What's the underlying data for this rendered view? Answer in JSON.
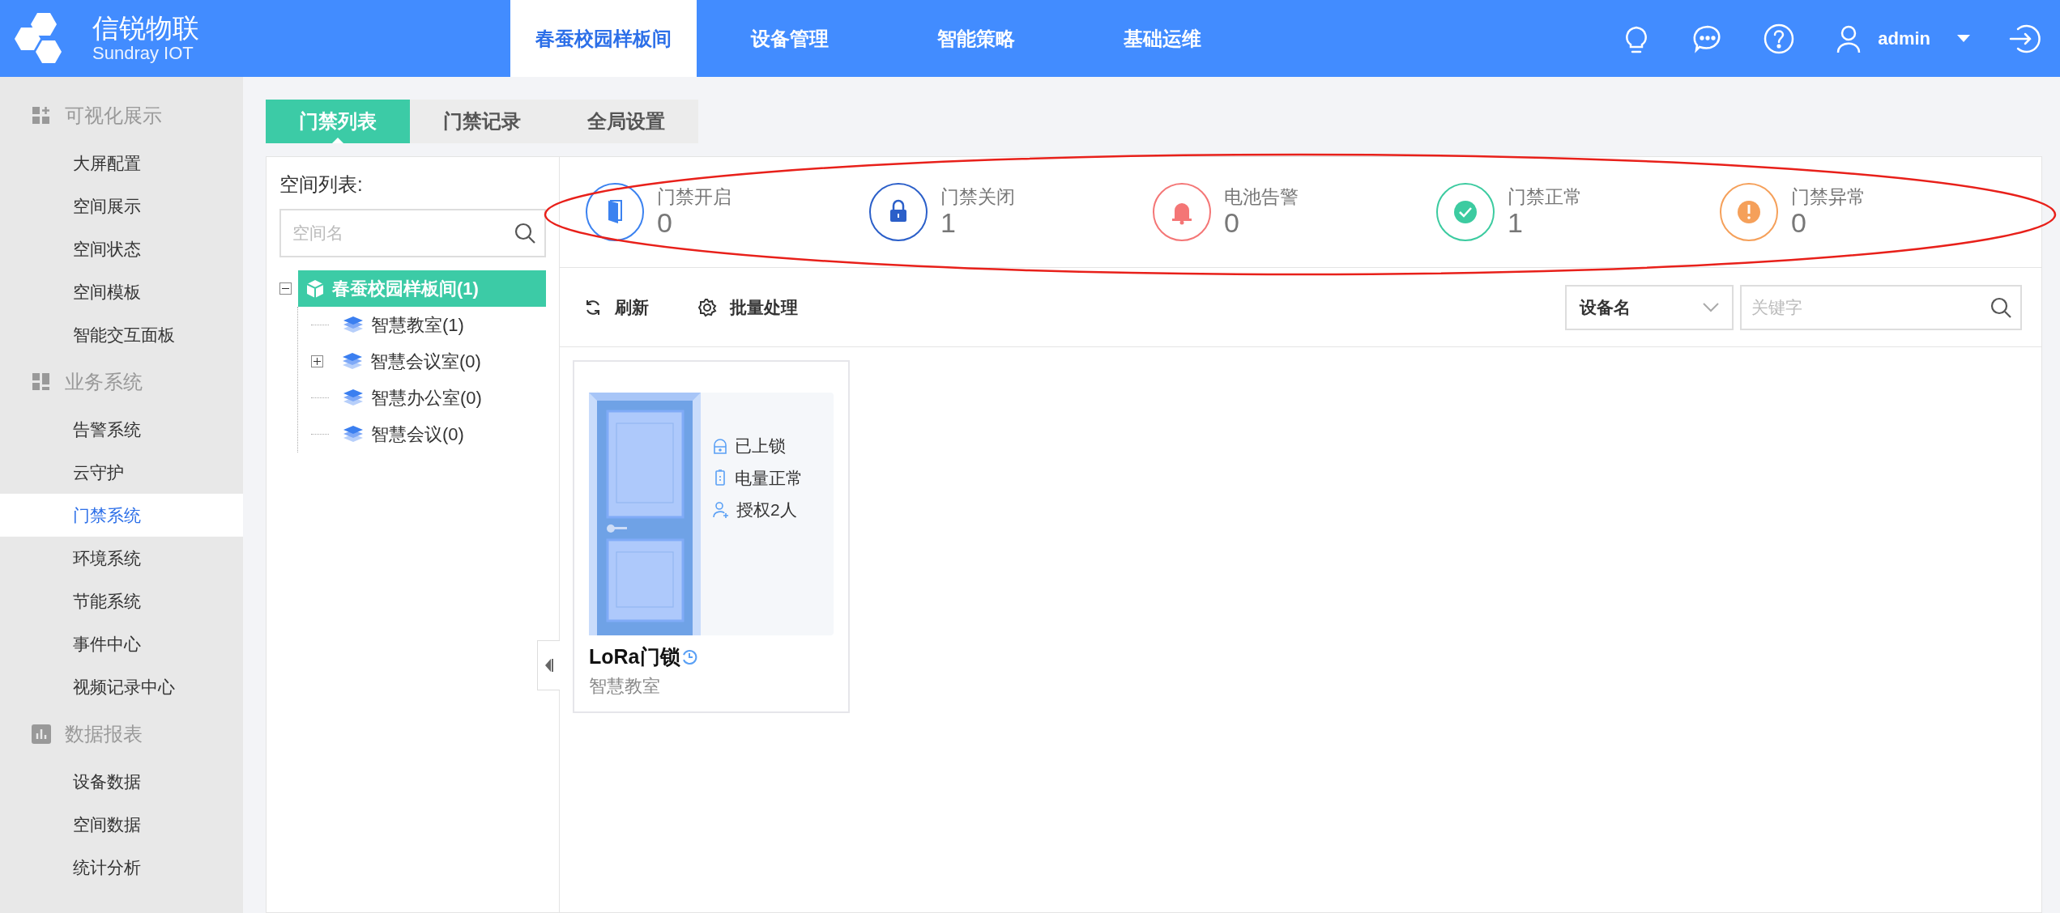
{
  "header": {
    "logo_title": "信锐物联",
    "logo_subtitle": "Sundray IOT",
    "user": "admin",
    "nav": [
      {
        "label": "春蚕校园样板间",
        "selected": true
      },
      {
        "label": "设备管理",
        "selected": false
      },
      {
        "label": "智能策略",
        "selected": false
      },
      {
        "label": "基础运维",
        "selected": false
      }
    ]
  },
  "sidebar": {
    "groups": [
      {
        "title": "可视化展示",
        "kind": "grid",
        "items": [
          {
            "label": "大屏配置",
            "selected": false
          },
          {
            "label": "空间展示",
            "selected": false
          },
          {
            "label": "空间状态",
            "selected": false
          },
          {
            "label": "空间模板",
            "selected": false
          },
          {
            "label": "智能交互面板",
            "selected": false
          }
        ]
      },
      {
        "title": "业务系统",
        "kind": "layout",
        "items": [
          {
            "label": "告警系统",
            "selected": false
          },
          {
            "label": "云守护",
            "selected": false
          },
          {
            "label": "门禁系统",
            "selected": true
          },
          {
            "label": "环境系统",
            "selected": false
          },
          {
            "label": "节能系统",
            "selected": false
          },
          {
            "label": "事件中心",
            "selected": false
          },
          {
            "label": "视频记录中心",
            "selected": false
          }
        ]
      },
      {
        "title": "数据报表",
        "kind": "chart",
        "items": [
          {
            "label": "设备数据",
            "selected": false
          },
          {
            "label": "空间数据",
            "selected": false
          },
          {
            "label": "统计分析",
            "selected": false
          }
        ]
      }
    ]
  },
  "tabs": [
    {
      "label": "门禁列表",
      "selected": true
    },
    {
      "label": "门禁记录",
      "selected": false
    },
    {
      "label": "全局设置",
      "selected": false
    }
  ],
  "space_panel": {
    "title": "空间列表:",
    "search": {
      "placeholder": "空间名"
    },
    "tree": [
      {
        "label": "春蚕校园样板间(1)",
        "selected": true,
        "expanded": true,
        "children": [
          {
            "label": "智慧教室(1)",
            "selected": false
          },
          {
            "label": "智慧会议室(0)",
            "selected": false,
            "expanded": false
          },
          {
            "label": "智慧办公室(0)",
            "selected": false
          },
          {
            "label": "智慧会议(0)",
            "selected": false
          }
        ]
      }
    ]
  },
  "stats": [
    {
      "kind": "open",
      "label": "门禁开启",
      "value": "0",
      "color": "#3b82f0"
    },
    {
      "kind": "closed",
      "label": "门禁关闭",
      "value": "1",
      "color": "#2b5fc9"
    },
    {
      "kind": "battery",
      "label": "电池告警",
      "value": "0",
      "color": "#f47676"
    },
    {
      "kind": "normal",
      "label": "门禁正常",
      "value": "1",
      "color": "#3ccba0"
    },
    {
      "kind": "abnormal",
      "label": "门禁异常",
      "value": "0",
      "color": "#f5a05a"
    }
  ],
  "toolbar": {
    "buttons": [
      {
        "kind": "refresh",
        "label": "刷新"
      },
      {
        "kind": "batch",
        "label": "批量处理"
      }
    ],
    "filter": {
      "value": "设备名"
    },
    "search": {
      "placeholder": "关键字"
    }
  },
  "devices": [
    {
      "name": "LoRa门锁",
      "location": "智慧教室",
      "status": [
        {
          "kind": "lock",
          "text": "已上锁"
        },
        {
          "kind": "battery",
          "text": "电量正常"
        },
        {
          "kind": "user",
          "text": "授权2人"
        }
      ]
    }
  ]
}
